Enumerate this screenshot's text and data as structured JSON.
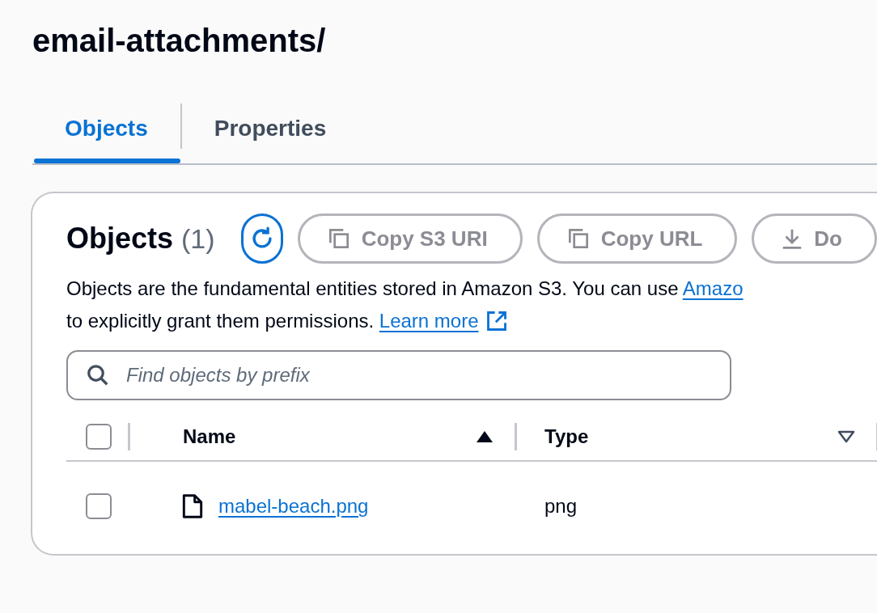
{
  "page_title": "email-attachments/",
  "tabs": [
    {
      "label": "Objects",
      "selected": true
    },
    {
      "label": "Properties",
      "selected": false
    }
  ],
  "panel": {
    "title": "Objects",
    "count": "(1)",
    "actions": [
      {
        "label": "Copy S3 URI",
        "kind": "copy",
        "disabled": true
      },
      {
        "label": "Copy URL",
        "kind": "copy",
        "disabled": true
      },
      {
        "label": "Do",
        "kind": "download",
        "disabled": true
      }
    ],
    "description": {
      "text_1": "Objects are the fundamental entities stored in Amazon S3. You can use ",
      "link_1": "Amazo",
      "text_2": "to explicitly grant them permissions. ",
      "link_2": "Learn more"
    },
    "search": {
      "placeholder": "Find objects by prefix"
    },
    "table": {
      "select_all_checked": false,
      "columns": [
        {
          "label": "Name",
          "sorted": true
        },
        {
          "label": "Type",
          "sorted": false
        }
      ],
      "rows": [
        {
          "checked": false,
          "name": "mabel-beach.png",
          "type": "png"
        }
      ]
    }
  }
}
